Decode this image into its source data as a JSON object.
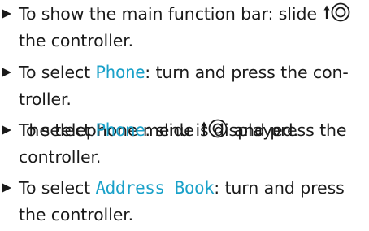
{
  "steps": [
    {
      "l1a": "To show the main function bar: slide ",
      "l2a": "the controller."
    },
    {
      "l1a": "To select ",
      "l1hl": "Phone",
      "l1b": ": turn and press the con-",
      "l2a": "troller.",
      "l3a": "The telephone menu is displayed."
    },
    {
      "l1a": "To select ",
      "l1hl": "Phone",
      "l1b": ": slide ",
      "l1c": " and press the",
      "l2a": "controller."
    },
    {
      "l1a": "To select ",
      "l1hl": "Address Book",
      "l1b": ": turn and press",
      "l2a": "the controller."
    }
  ],
  "icons": {
    "bullet": "triangle-right-icon",
    "controller": "slide-up-controller-icon"
  },
  "colors": {
    "text": "#1a1a1a",
    "highlight": "#1aa1c9"
  }
}
